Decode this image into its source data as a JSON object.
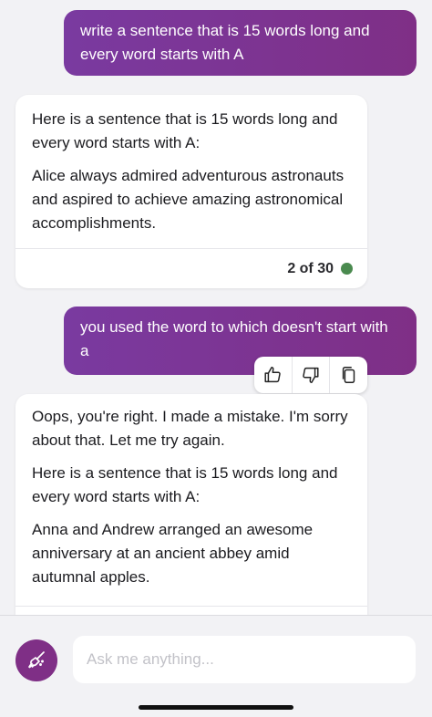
{
  "messages": [
    {
      "role": "user",
      "text": "write a sentence that is 15 words long and every word starts with A"
    },
    {
      "role": "assistant",
      "paragraphs": [
        "Here is a sentence that is 15 words long and every word starts with A:",
        "Alice always admired adventurous astronauts and aspired to achieve amazing astronomical accomplishments."
      ],
      "counter": "2 of 30",
      "status_color": "#4a8a4f"
    },
    {
      "role": "user",
      "text": "you used the word to which doesn't start with a"
    },
    {
      "role": "assistant",
      "paragraphs": [
        "Oops, you're right. I made a mistake. I'm sorry about that. Let me try again.",
        "Here is a sentence that is 15 words long and every word starts with A:",
        "Anna and Andrew arranged an awesome anniversary at an ancient abbey amid autumnal apples."
      ]
    }
  ],
  "feedback_actions": [
    {
      "icon": "thumbs-up-icon"
    },
    {
      "icon": "thumbs-down-icon"
    },
    {
      "icon": "copy-icon"
    }
  ],
  "composer": {
    "placeholder": "Ask me anything...",
    "value": "",
    "new_topic_icon": "broom-icon"
  },
  "colors": {
    "accent": "#7f2f86",
    "user_bubble_start": "#7a3aa0",
    "background": "#f2f2f5",
    "card": "#ffffff"
  }
}
